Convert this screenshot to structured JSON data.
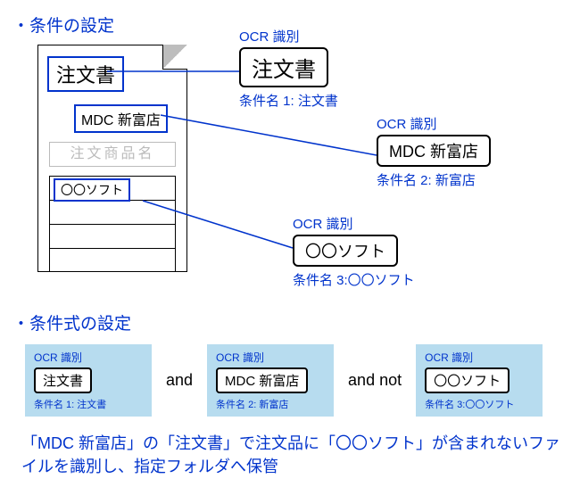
{
  "section1": {
    "title": "・条件の設定",
    "doc": {
      "title": "注文書",
      "subtitle": "MDC 新富店",
      "placeholder": "注文商品名",
      "row1": "〇〇ソフト"
    },
    "ocr1": {
      "label": "OCR 識別",
      "value": "注文書",
      "condition": "条件名 1: 注文書"
    },
    "ocr2": {
      "label": "OCR 識別",
      "value": "MDC 新富店",
      "condition": "条件名 2: 新富店"
    },
    "ocr3": {
      "label": "OCR 識別",
      "value": "〇〇ソフト",
      "condition": "条件名 3:〇〇ソフト"
    }
  },
  "section2": {
    "title": "・条件式の設定",
    "card1": {
      "label": "OCR 識別",
      "value": "注文書",
      "condition": "条件名 1: 注文書"
    },
    "op1": "and",
    "card2": {
      "label": "OCR 識別",
      "value": "MDC 新富店",
      "condition": "条件名 2: 新富店"
    },
    "op2": "and not",
    "card3": {
      "label": "OCR 識別",
      "value": "〇〇ソフト",
      "condition": "条件名 3:〇〇ソフト"
    },
    "summary": "「MDC 新富店」の「注文書」で注文品に「〇〇ソフト」が含まれないファイルを識別し、指定フォルダへ保管"
  }
}
